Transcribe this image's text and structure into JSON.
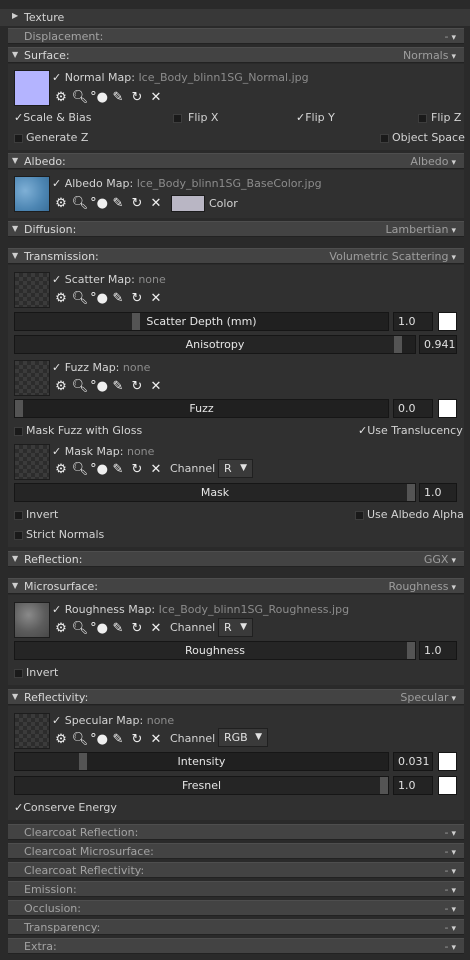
{
  "texture_header": "Texture",
  "displacement_header": "Displacement:",
  "surface": {
    "title": "Surface:",
    "mode": "Normals",
    "map_label": "Normal Map:",
    "map_file": "Ice_Body_blinn1SG_Normal.jpg",
    "scale_bias": "Scale & Bias",
    "flip_x": "Flip X",
    "flip_y": "Flip Y",
    "flip_z": "Flip Z",
    "generate_z": "Generate Z",
    "object_space": "Object Space"
  },
  "albedo": {
    "title": "Albedo:",
    "mode": "Albedo",
    "map_label": "Albedo Map:",
    "map_file": "Ice_Body_blinn1SG_BaseColor.jpg",
    "color_label": "Color",
    "color_value": "#b9b6c4"
  },
  "diffusion": {
    "title": "Diffusion:",
    "mode": "Lambertian"
  },
  "transmission": {
    "title": "Transmission:",
    "mode": "Volumetric Scattering",
    "scatter_map_label": "Scatter Map:",
    "scatter_map_file": "none",
    "scatter_depth_label": "Scatter Depth (mm)",
    "scatter_depth_value": "1.0",
    "anisotropy_label": "Anisotropy",
    "anisotropy_value": "0.941",
    "fuzz_map_label": "Fuzz Map:",
    "fuzz_map_file": "none",
    "fuzz_label": "Fuzz",
    "fuzz_value": "0.0",
    "mask_fuzz_gloss": "Mask Fuzz with Gloss",
    "use_translucency": "Use Translucency",
    "mask_map_label": "Mask Map:",
    "mask_map_file": "none",
    "channel_label": "Channel",
    "mask_channel": "R",
    "mask_label": "Mask",
    "mask_value": "1.0",
    "invert": "Invert",
    "use_albedo_alpha": "Use Albedo Alpha",
    "strict_normals": "Strict Normals"
  },
  "reflection": {
    "title": "Reflection:",
    "mode": "GGX"
  },
  "microsurface": {
    "title": "Microsurface:",
    "mode": "Roughness",
    "map_label": "Roughness Map:",
    "map_file": "Ice_Body_blinn1SG_Roughness.jpg",
    "channel_label": "Channel",
    "channel": "R",
    "roughness_label": "Roughness",
    "roughness_value": "1.0",
    "invert": "Invert"
  },
  "reflectivity": {
    "title": "Reflectivity:",
    "mode": "Specular",
    "map_label": "Specular Map:",
    "map_file": "none",
    "channel_label": "Channel",
    "channel": "RGB",
    "intensity_label": "Intensity",
    "intensity_value": "0.031",
    "fresnel_label": "Fresnel",
    "fresnel_value": "1.0",
    "conserve_energy": "Conserve Energy"
  },
  "collapsed": [
    {
      "label": "Clearcoat Reflection:"
    },
    {
      "label": "Clearcoat Microsurface:"
    },
    {
      "label": "Clearcoat Reflectivity:"
    },
    {
      "label": "Emission:"
    },
    {
      "label": "Occlusion:"
    },
    {
      "label": "Transparency:"
    },
    {
      "label": "Extra:"
    }
  ],
  "collapsed_mode": "-",
  "icons": [
    "gear-icon",
    "magnifier-icon",
    "eyedropper-icon",
    "pencil-icon",
    "reload-icon",
    "close-icon",
    "checkmark-icon",
    "dropdown-arrow-icon"
  ]
}
